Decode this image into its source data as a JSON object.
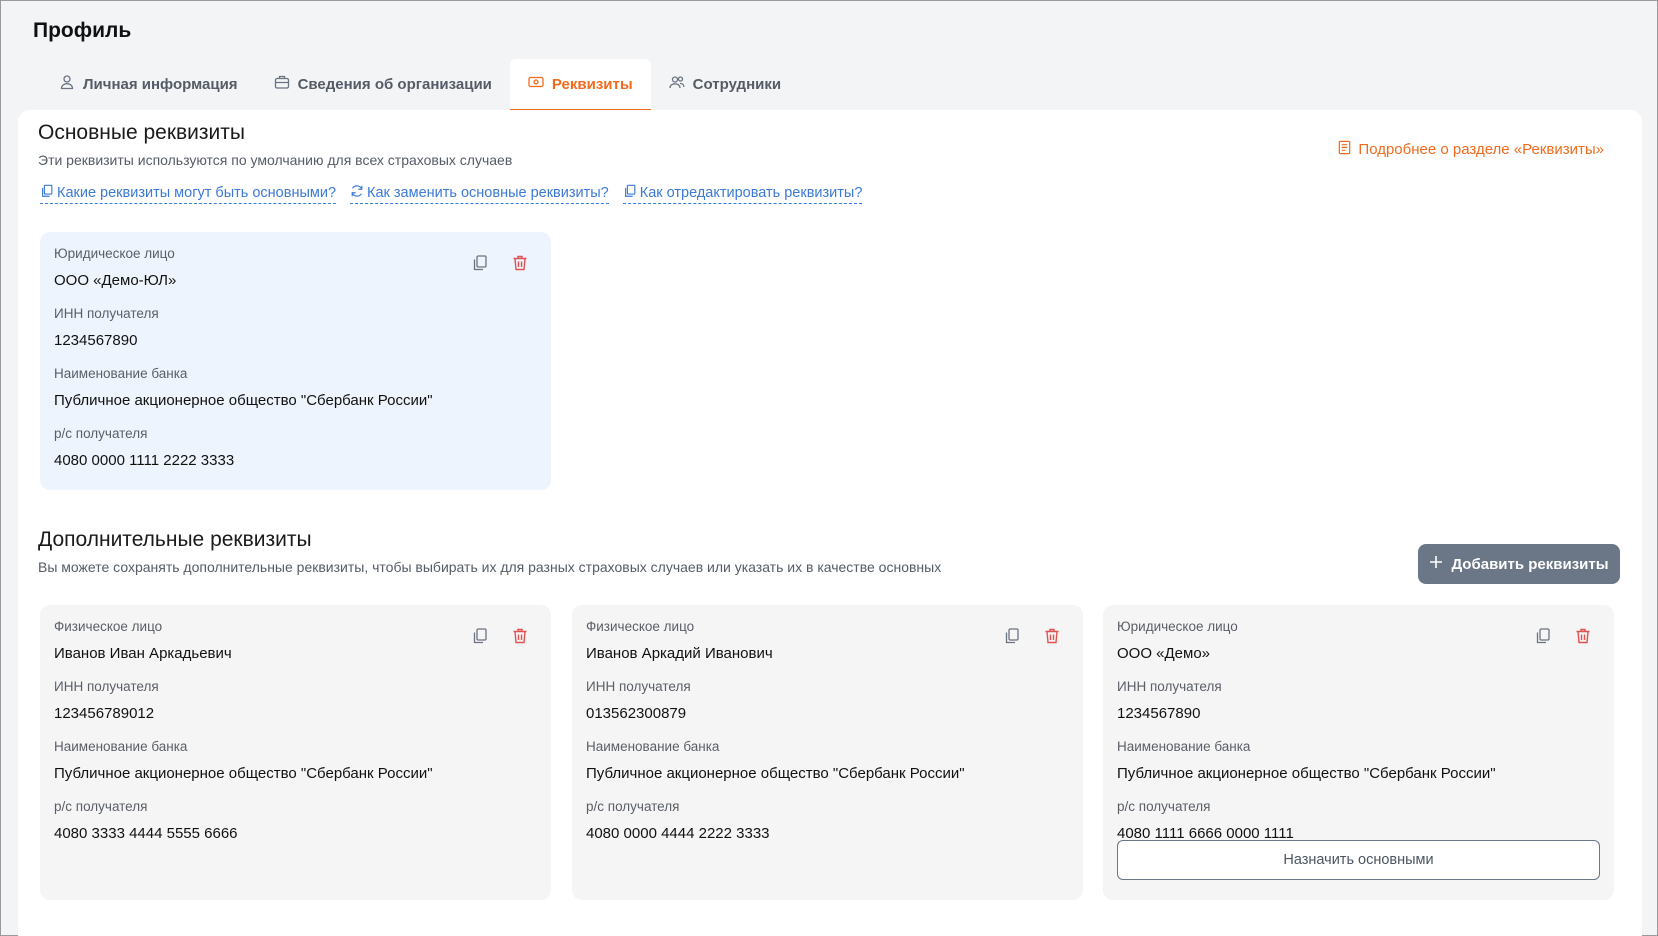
{
  "page": {
    "title": "Профиль"
  },
  "tabs": [
    {
      "label": "Личная информация",
      "icon": "user-icon",
      "active": false
    },
    {
      "label": "Сведения об организации",
      "icon": "briefcase-icon",
      "active": false
    },
    {
      "label": "Реквизиты",
      "icon": "banknote-icon",
      "active": true
    },
    {
      "label": "Сотрудники",
      "icon": "users-icon",
      "active": false
    }
  ],
  "main_section": {
    "title": "Основные реквизиты",
    "description": "Эти реквизиты используются по умолчанию для всех страховых случаев",
    "more_link": "Подробнее о разделе «Реквизиты»",
    "help_links": [
      "Какие реквизиты могут быть основными?",
      "Как заменить основные реквизиты?",
      "Как отредактировать реквизиты?"
    ],
    "card": {
      "type": "Юридическое лицо",
      "name": "ООО «Демо-ЮЛ»",
      "inn_label": "ИНН получателя",
      "inn": "1234567890",
      "bank_label": "Наименование банка",
      "bank": "Публичное акционерное общество \"Сбербанк России\"",
      "account_label": "р/с получателя",
      "account": "4080 0000 1111 2222 3333"
    }
  },
  "extra_section": {
    "title": "Дополнительные реквизиты",
    "description": "Вы можете сохранять дополнительные реквизиты, чтобы выбирать их для разных страховых случаев или указать их в качестве основных",
    "add_button": "Добавить реквизиты",
    "set_main_button": "Назначить основными",
    "cards": [
      {
        "type": "Физическое лицо",
        "name": "Иванов Иван Аркадьевич",
        "inn_label": "ИНН получателя",
        "inn": "123456789012",
        "bank_label": "Наименование банка",
        "bank": "Публичное акционерное общество \"Сбербанк России\"",
        "account_label": "р/с получателя",
        "account": "4080 3333 4444 5555 6666"
      },
      {
        "type": "Физическое лицо",
        "name": "Иванов Аркадий Иванович",
        "inn_label": "ИНН получателя",
        "inn": "013562300879",
        "bank_label": "Наименование банка",
        "bank": "Публичное акционерное общество \"Сбербанк России\"",
        "account_label": "р/с получателя",
        "account": "4080 0000 4444 2222 3333"
      },
      {
        "type": "Юридическое лицо",
        "name": "ООО «Демо»",
        "inn_label": "ИНН получателя",
        "inn": "1234567890",
        "bank_label": "Наименование банка",
        "bank": "Публичное акционерное общество \"Сбербанк России\"",
        "account_label": "р/с получателя",
        "account": "4080 1111 6666 0000 1111"
      }
    ]
  },
  "colors": {
    "accent": "#f26b1d",
    "link": "#3b7ad9",
    "delete": "#e05252",
    "main_card_bg": "#eef4fd",
    "card_bg": "#f5f5f6",
    "button_bg": "#6b7686"
  }
}
